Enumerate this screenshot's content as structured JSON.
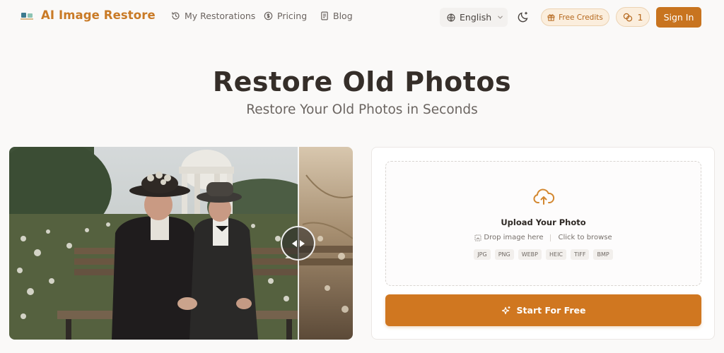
{
  "header": {
    "logo_text": "AI Image Restore",
    "nav": [
      {
        "label": "My Restorations",
        "icon": "history-icon"
      },
      {
        "label": "Pricing",
        "icon": "dollar-circle-icon"
      },
      {
        "label": "Blog",
        "icon": "document-icon"
      }
    ],
    "language": "English",
    "free_credits_label": "Free Credits",
    "credit_count": "1",
    "sign_in_label": "Sign In"
  },
  "hero": {
    "title": "Restore Old Photos",
    "subtitle": "Restore Your Old Photos in Seconds"
  },
  "upload": {
    "title": "Upload Your Photo",
    "drop_text": "Drop image here",
    "browse_text": "Click to browse",
    "formats": [
      "JPG",
      "PNG",
      "WEBP",
      "HEIC",
      "TIFF",
      "BMP"
    ],
    "start_label": "Start For Free"
  },
  "colors": {
    "accent": "#c8741f",
    "accent_light": "#fbeedd",
    "title": "#352e29"
  }
}
